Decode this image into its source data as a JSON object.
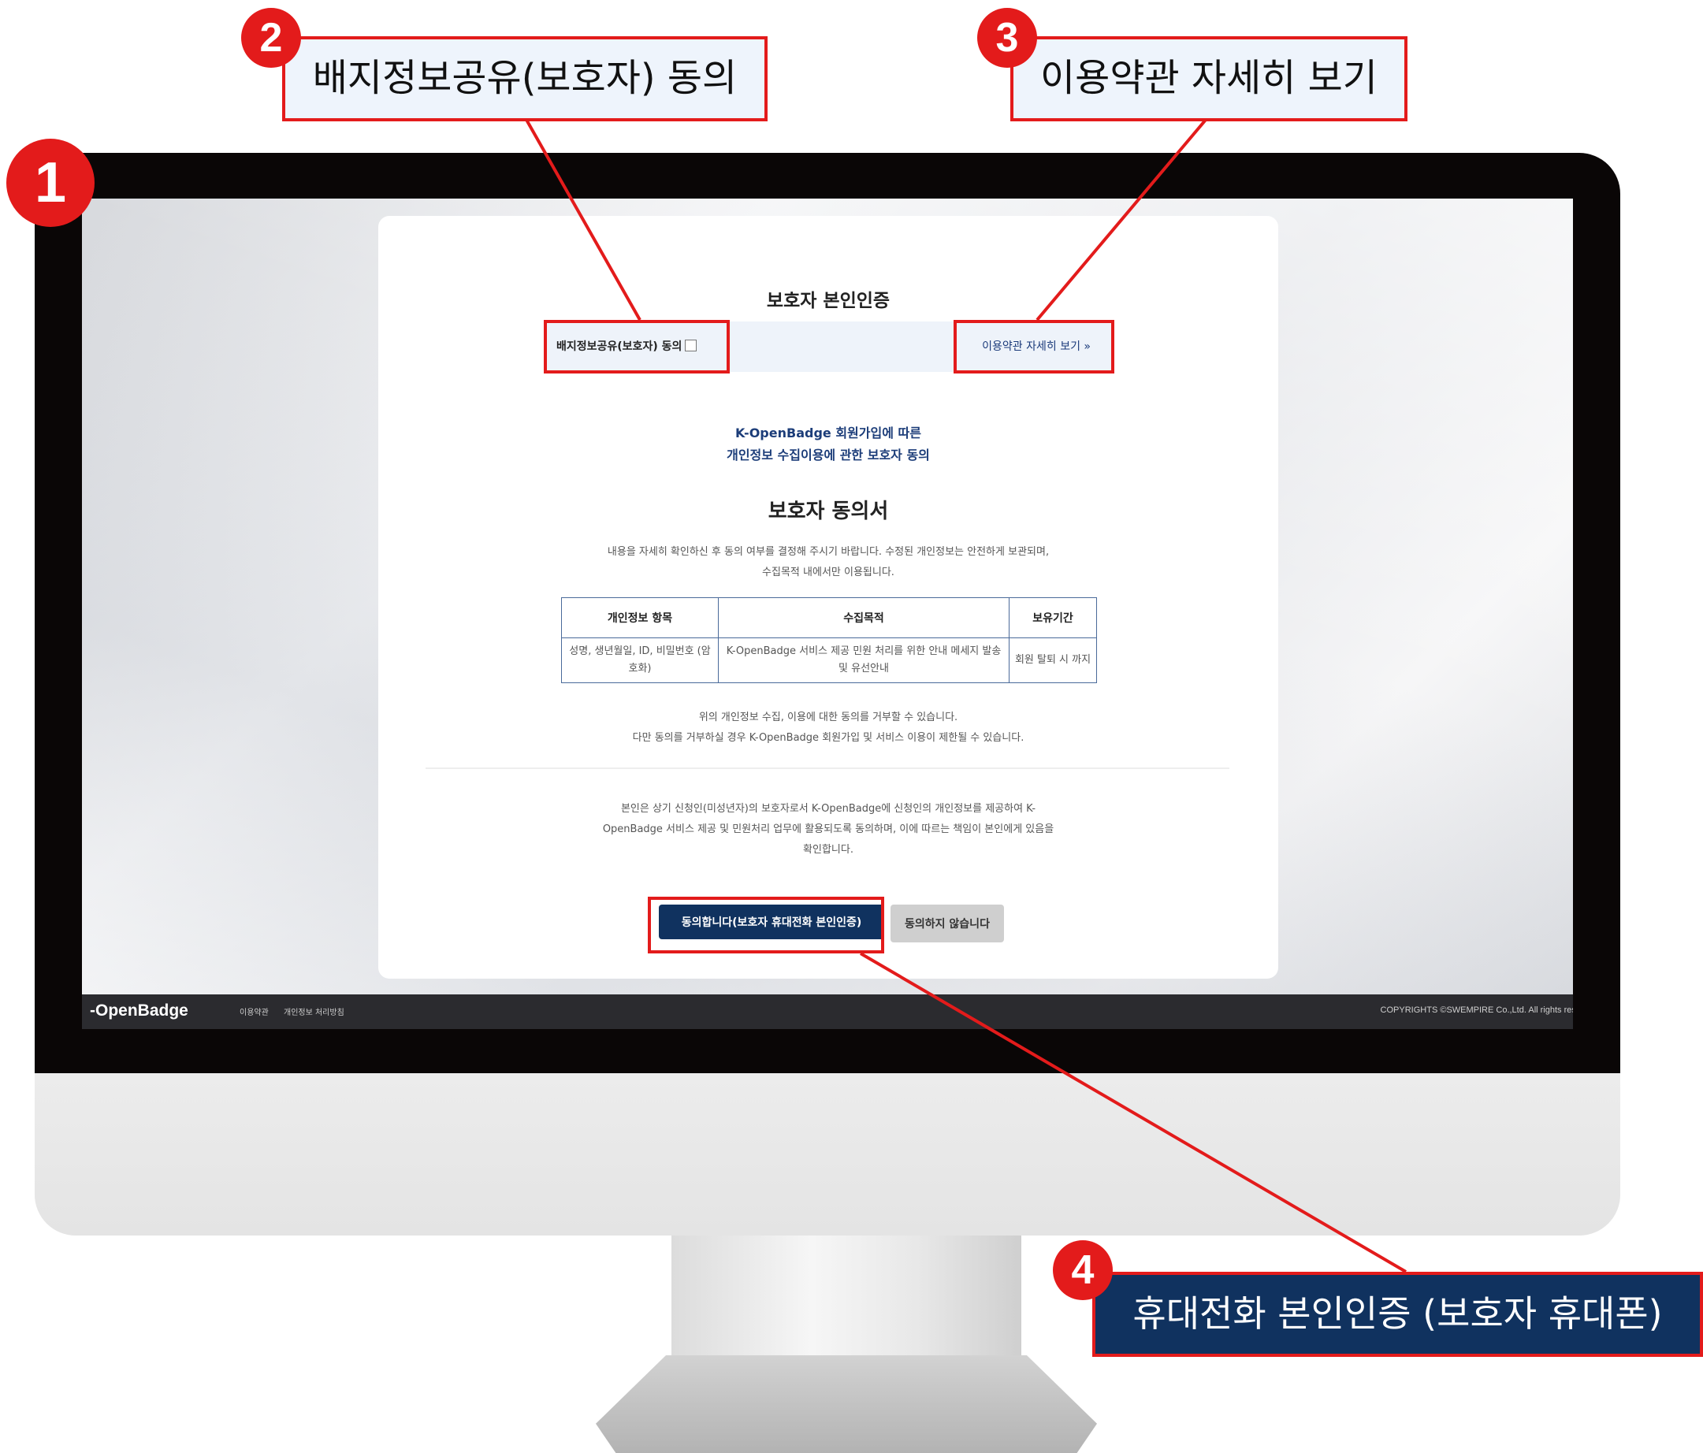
{
  "annotations": {
    "n1": "1",
    "n2": "2",
    "n3": "3",
    "n4": "4",
    "callout2": "배지정보공유(보호자) 동의",
    "callout3": "이용약관 자세히 보기",
    "callout4": "휴대전화 본인인증 (보호자 휴대폰)",
    "accent_color": "#e31b1b",
    "dark_color": "#10325f"
  },
  "page": {
    "title": "보호자 본인인증",
    "agree_label": "배지정보공유(보호자) 동의",
    "terms_link": "이용약관 자세히 보기 »",
    "subtitle_line1": "K-OpenBadge 회원가입에 따른",
    "subtitle_line2": "개인정보 수집이용에 관한 보호자 동의",
    "doc_title": "보호자 동의서",
    "intro_line1": "내용을 자세히 확인하신 후 동의 여부를 결정해 주시기 바랍니다. 수정된 개인정보는 안전하게 보관되며,",
    "intro_line2": "수집목적 내에서만 이용됩니다.",
    "table": {
      "headers": [
        "개인정보 항목",
        "수집목적",
        "보유기간"
      ],
      "row": [
        "성명, 생년월일, ID, 비밀번호 (암호화)",
        "K-OpenBadge 서비스 제공 민원 처리를 위한 안내 메세지 발송 및 유선안내",
        "회원 탈퇴 시 까지"
      ]
    },
    "refuse_line1": "위의 개인정보 수집, 이용에 대한 동의를 거부할 수 있습니다.",
    "refuse_line2": "다만 동의를 거부하실 경우 K-OpenBadge 회원가입 및 서비스 이용이 제한될 수 있습니다.",
    "confirm_line1": "본인은 상기 신청인(미성년자)의 보호자로서 K-OpenBadge에 신청인의 개인정보를 제공하여 K-",
    "confirm_line2": "OpenBadge 서비스 제공 및 민원처리 업무에 활용되도록 동의하며, 이에 따르는 책임이 본인에게 있음을",
    "confirm_line3": "확인합니다.",
    "agree_button": "동의합니다(보호자 휴대전화 본인인증)",
    "decline_button": "동의하지 않습니다"
  },
  "footer": {
    "logo": "-OpenBadge",
    "link1": "이용약관",
    "link2": "개인정보 처리방침",
    "copyright": "COPYRIGHTS ©SWEMPIRE Co.,Ltd. All rights rese"
  }
}
